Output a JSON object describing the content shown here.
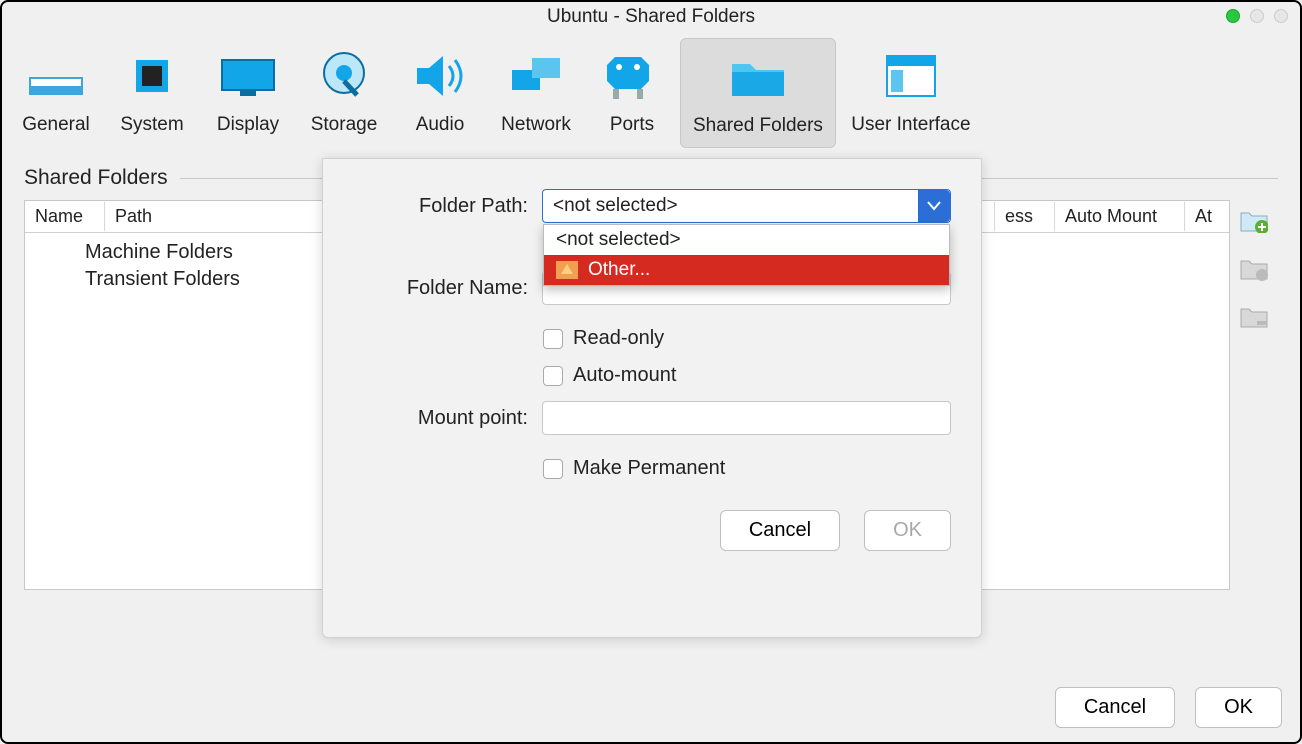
{
  "window": {
    "title": "Ubuntu - Shared Folders"
  },
  "toolbar": {
    "items": [
      {
        "label": "General"
      },
      {
        "label": "System"
      },
      {
        "label": "Display"
      },
      {
        "label": "Storage"
      },
      {
        "label": "Audio"
      },
      {
        "label": "Network"
      },
      {
        "label": "Ports"
      },
      {
        "label": "Shared Folders"
      },
      {
        "label": "User Interface"
      }
    ],
    "selected_index": 7
  },
  "section": {
    "title": "Shared Folders"
  },
  "table": {
    "columns": {
      "name": "Name",
      "path": "Path",
      "ess": "ess",
      "auto_mount": "Auto Mount",
      "at": "At"
    },
    "rows": [
      {
        "label": "Machine Folders"
      },
      {
        "label": "Transient Folders"
      }
    ]
  },
  "dialog": {
    "labels": {
      "folder_path": "Folder Path:",
      "folder_name": "Folder Name:",
      "mount_point": "Mount point:"
    },
    "select": {
      "value": "<not selected>",
      "options": [
        {
          "label": "<not selected>"
        },
        {
          "label": "Other..."
        }
      ],
      "highlight_index": 1
    },
    "checkboxes": {
      "read_only": "Read-only",
      "auto_mount": "Auto-mount",
      "make_permanent": "Make Permanent"
    },
    "buttons": {
      "cancel": "Cancel",
      "ok": "OK"
    }
  },
  "footer": {
    "cancel": "Cancel",
    "ok": "OK"
  }
}
